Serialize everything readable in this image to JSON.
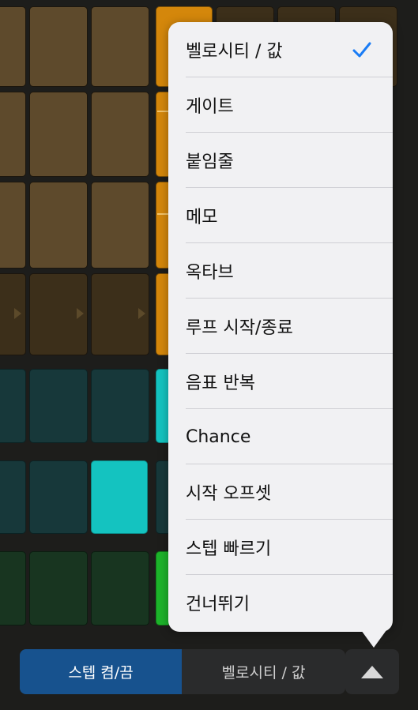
{
  "colors": {
    "menu_bg": "#f1f1f3",
    "check": "#1a7cf5",
    "active_segment": "#17528e",
    "orange_step": "#d4870b",
    "cyan_step": "#14c3c0",
    "green_step": "#1db32a"
  },
  "menu": {
    "items": [
      {
        "label": "벨로시티 / 값",
        "selected": true
      },
      {
        "label": "게이트",
        "selected": false
      },
      {
        "label": "붙임줄",
        "selected": false
      },
      {
        "label": "메모",
        "selected": false
      },
      {
        "label": "옥타브",
        "selected": false
      },
      {
        "label": "루프 시작/종료",
        "selected": false
      },
      {
        "label": "음표 반복",
        "selected": false
      },
      {
        "label": "Chance",
        "selected": false
      },
      {
        "label": "시작 오프셋",
        "selected": false
      },
      {
        "label": "스텝 빠르기",
        "selected": false
      },
      {
        "label": "건너뛰기",
        "selected": false
      }
    ]
  },
  "bottom": {
    "segments": [
      {
        "label": "스텝 켬/끔",
        "active": true
      },
      {
        "label": "벨로시티 / 값",
        "active": false
      }
    ],
    "expand_icon": "triangle-up-icon"
  }
}
